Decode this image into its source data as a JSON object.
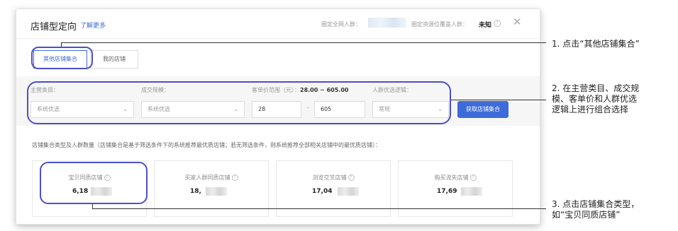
{
  "modal": {
    "title": "店铺型定向",
    "learn_more": "了解更多",
    "crowd_label": "圈定全网人群：",
    "cover_label": "圈定资源位覆盖人群：",
    "cover_value": "未知",
    "help_glyph": "?",
    "close_glyph": "✕"
  },
  "tabs": [
    {
      "label": "其他店铺集合",
      "active": true
    },
    {
      "label": "我的店铺",
      "active": false
    }
  ],
  "filters": {
    "category_label": "主营类目：",
    "category_value": "系统优选",
    "scale_label": "成交规模：",
    "scale_value": "系统优选",
    "price_label_prefix": "客单价范围（元）：",
    "price_range_text": "28.00 ~ 605.00",
    "price_min": "28",
    "price_sep": "–",
    "price_max": "605",
    "logic_label": "人群优选逻辑：",
    "logic_value": "常规",
    "chevron": "⌄",
    "get_button": "获取店铺集合"
  },
  "description": "店铺集合类型及人群数量（店铺集合是基于筛选条件下的系统推荐最优质店铺；若无筛选条件，则系统推荐全部相关店铺中的最优质店铺）：",
  "cards": [
    {
      "name": "宝贝同质店铺",
      "value": "6,18"
    },
    {
      "name": "买家人群同质店铺",
      "value": "18,"
    },
    {
      "name": "浏览交叉店铺",
      "value": "17,04"
    },
    {
      "name": "购买流失店铺",
      "value": "17,69"
    }
  ],
  "callouts": {
    "step1": "1. 点击“其他店铺集合”",
    "step2_line1": "2. 在主营类目、成交规",
    "step2_line2": "模、客单价和人群优选",
    "step2_line3": "逻辑上进行组合选择",
    "step3_line1": "3. 点击店铺集合类型，",
    "step3_line2": "如“宝贝同质店铺”"
  },
  "colors": {
    "accent": "#3d6bd9",
    "highlight": "#4b4fc9"
  }
}
